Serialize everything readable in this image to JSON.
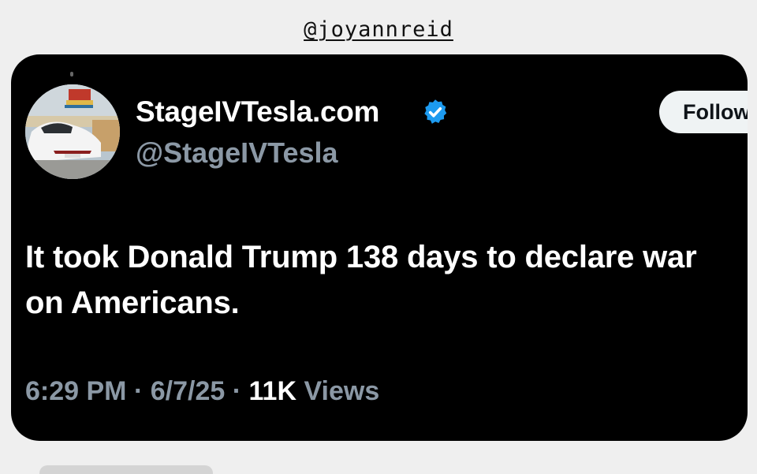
{
  "credit": {
    "handle": "@joyannreid"
  },
  "tweet": {
    "display_name": "StageIVTesla.com",
    "handle": "@StageIVTesla",
    "follow_label": "Follow",
    "text": "It took Donald Trump 138 days to declare war on Americans.",
    "time": "6:29 PM",
    "date": "6/7/25",
    "views_count": "11K",
    "views_label": "Views",
    "separator": "·"
  },
  "colors": {
    "background": "#efefef",
    "card": "#000000",
    "verified_blue": "#1d9bf0",
    "secondary_text": "#8b98a5",
    "follow_bg": "#eff3f4"
  },
  "icons": {
    "verified": "verified-badge-icon",
    "avatar": "tesla-car-photo"
  }
}
